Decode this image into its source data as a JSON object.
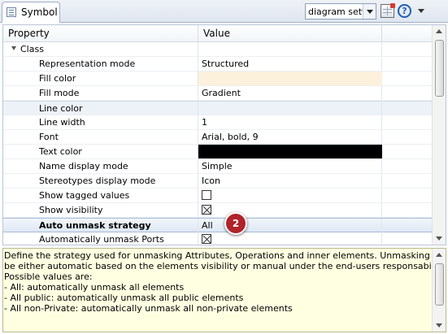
{
  "view": {
    "tab_label": "Symbol",
    "combo_value": "diagram settings",
    "icons": [
      "properties-grid-icon",
      "help-icon",
      "view-menu-icon"
    ]
  },
  "grid": {
    "headers": {
      "property": "Property",
      "value": "Value"
    },
    "group_label": "Class",
    "rows": [
      {
        "label": "Representation mode",
        "value": "Structured",
        "kind": "text"
      },
      {
        "label": "Fill color",
        "value": "",
        "kind": "color",
        "color": "#fbf1dc"
      },
      {
        "label": "Fill mode",
        "value": "Gradient",
        "kind": "text"
      },
      {
        "label": "Line color",
        "value": "",
        "kind": "group"
      },
      {
        "label": "Line width",
        "value": "1",
        "kind": "text"
      },
      {
        "label": "Font",
        "value": "Arial, bold, 9",
        "kind": "text"
      },
      {
        "label": "Text color",
        "value": "",
        "kind": "color",
        "color": "#000000"
      },
      {
        "label": "Name display mode",
        "value": "Simple",
        "kind": "text"
      },
      {
        "label": "Stereotypes display mode",
        "value": "Icon",
        "kind": "text"
      },
      {
        "label": "Show tagged values",
        "value": "",
        "kind": "checkbox",
        "checked": false
      },
      {
        "label": "Show visibility",
        "value": "",
        "kind": "checkbox",
        "checked": true
      },
      {
        "label": "Auto unmask strategy",
        "value": "All",
        "kind": "text",
        "selected": true
      },
      {
        "label": "Automatically unmask Ports",
        "value": "",
        "kind": "checkbox",
        "checked": true
      }
    ],
    "callout_number": "2"
  },
  "description": {
    "lines": [
      "Define the strategy used for unmasking Attributes, Operations and inner elements. Unmasking can",
      "be either automatic based on the elements visibility or manual under the end-users responsability.",
      "Possible values are:",
      "- All: automatically unmask all elements",
      "- All public: automatically unmask all public elements",
      "- All non-Private: automatically unmask all non-private elements"
    ]
  },
  "colors": {
    "selection": "#dfe8f5",
    "description_bg": "#ffffe1",
    "callout": "#b0232a"
  }
}
